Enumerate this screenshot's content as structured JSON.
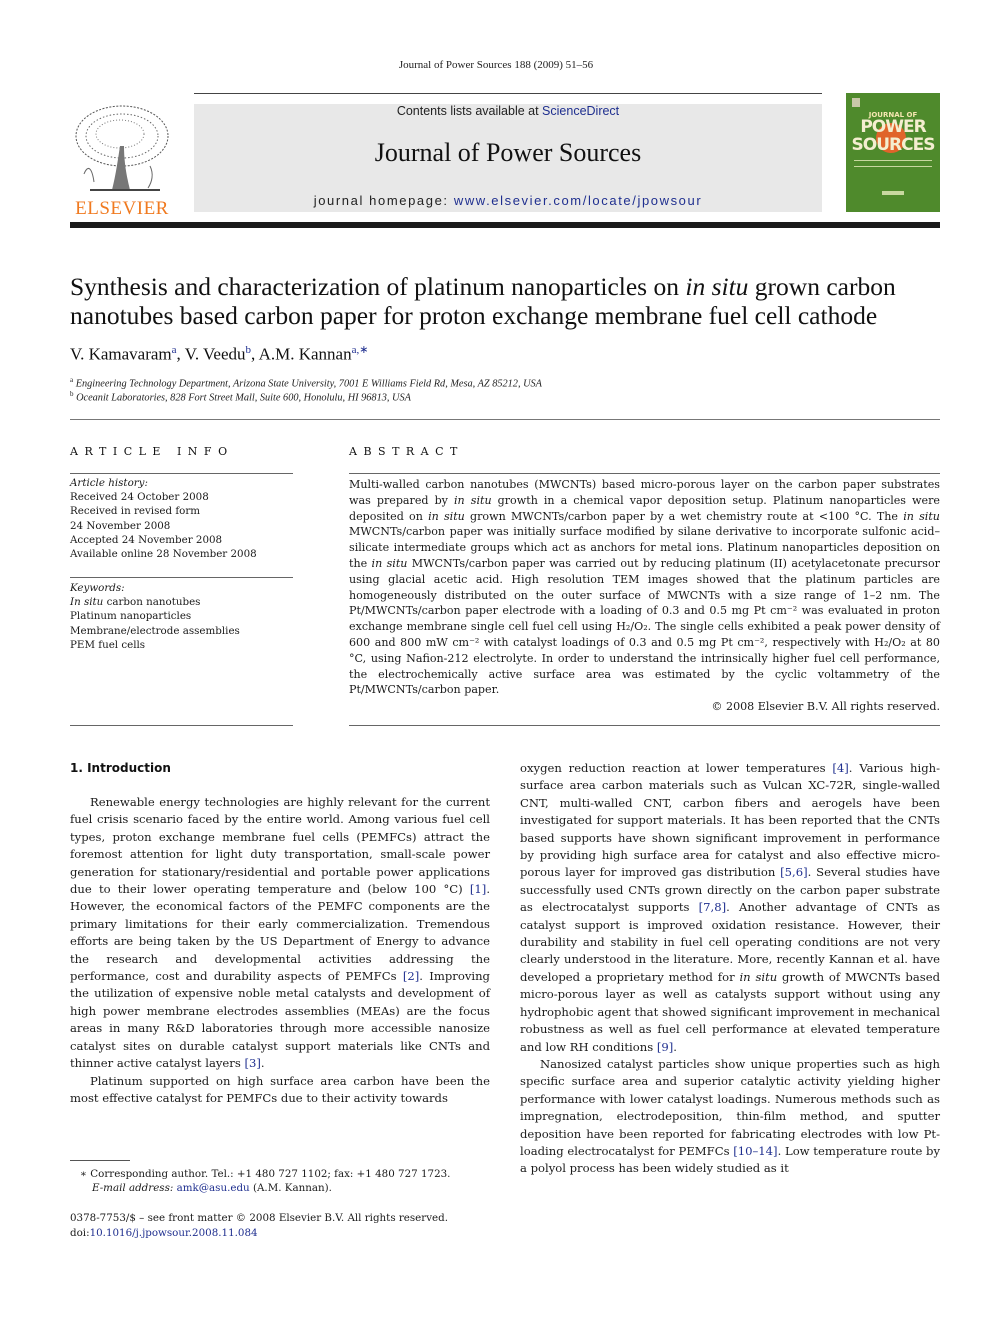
{
  "running_header": "Journal of Power Sources 188 (2009) 51–56",
  "masthead": {
    "publisher_logo_text": "ELSEVIER",
    "contents_prefix": "Contents lists available at ",
    "contents_link": "ScienceDirect",
    "journal_title": "Journal of Power Sources",
    "homepage_prefix": "journal homepage: ",
    "homepage_link": "www.elsevier.com/locate/jpowsour",
    "cover_small": "JOURNAL OF",
    "cover_title_1": "POWER",
    "cover_title_2": "SOURCES"
  },
  "article": {
    "title_part1": "Synthesis and characterization of platinum nanoparticles on ",
    "title_italic": "in situ",
    "title_part2": " grown carbon nanotubes based carbon paper for proton exchange membrane fuel cell cathode",
    "authors": [
      {
        "name": "V. Kamavaram",
        "sup": "a",
        "sep": ", "
      },
      {
        "name": "V. Veedu",
        "sup": "b",
        "sep": ", "
      },
      {
        "name": "A.M. Kannan",
        "sup": "a,∗",
        "sep": ""
      }
    ],
    "affiliations": [
      {
        "sup": "a",
        "text": "Engineering Technology Department, Arizona State University, 7001 E Williams Field Rd, Mesa, AZ 85212, USA"
      },
      {
        "sup": "b",
        "text": "Oceanit Laboratories, 828 Fort Street Mall, Suite 600, Honolulu, HI 96813, USA"
      }
    ]
  },
  "article_info": {
    "heading": "ARTICLE INFO",
    "history_label": "Article history:",
    "history": [
      "Received 24 October 2008",
      "Received in revised form",
      "24 November 2008",
      "Accepted 24 November 2008",
      "Available online 28 November 2008"
    ],
    "keywords_label": "Keywords:",
    "keyword_1_italic": "In situ",
    "keyword_1_rest": " carbon nanotubes",
    "keywords": [
      "Platinum nanoparticles",
      "Membrane/electrode assemblies",
      "PEM fuel cells"
    ]
  },
  "abstract": {
    "heading": "ABSTRACT",
    "segments": [
      {
        "t": "Multi-walled carbon nanotubes (MWCNTs) based micro-porous layer on the carbon paper substrates was prepared by "
      },
      {
        "t": "in situ",
        "i": true
      },
      {
        "t": " growth in a chemical vapor deposition setup. Platinum nanoparticles were deposited on "
      },
      {
        "t": "in situ",
        "i": true
      },
      {
        "t": " grown MWCNTs/carbon paper by a wet chemistry route at <100 °C. The "
      },
      {
        "t": "in situ",
        "i": true
      },
      {
        "t": " MWCNTs/carbon paper was initially surface modified by silane derivative to incorporate sulfonic acid–silicate intermediate groups which act as anchors for metal ions. Platinum nanoparticles deposition on the "
      },
      {
        "t": "in situ",
        "i": true
      },
      {
        "t": " MWCNTs/carbon paper was carried out by reducing platinum (II) acetylacetonate precursor using glacial acetic acid. High resolution TEM images showed that the platinum particles are homogeneously distributed on the outer surface of MWCNTs with a size range of 1–2 nm. The Pt/MWCNTs/carbon paper electrode with a loading of 0.3 and 0.5 mg Pt cm⁻² was evaluated in proton exchange membrane single cell fuel cell using H₂/O₂. The single cells exhibited a peak power density of 600 and 800 mW cm⁻² with catalyst loadings of 0.3 and 0.5 mg Pt cm⁻², respectively with H₂/O₂ at 80 °C, using Nafion-212 electrolyte. In order to understand the intrinsically higher fuel cell performance, the electrochemically active surface area was estimated by the cyclic voltammetry of the Pt/MWCNTs/carbon paper."
      }
    ],
    "copyright": "© 2008 Elsevier B.V. All rights reserved."
  },
  "introduction": {
    "heading": "1.  Introduction",
    "left_paragraphs": [
      [
        {
          "t": "Renewable energy technologies are highly relevant for the current fuel crisis scenario faced by the entire world. Among various fuel cell types, proton exchange membrane fuel cells (PEMFCs) attract the foremost attention for light duty transportation, small-scale power generation for stationary/residential and portable power applications due to their lower operating temperature and (below 100 °C) "
        },
        {
          "t": "[1]",
          "ref": true
        },
        {
          "t": ". However, the economical factors of the PEMFC components are the primary limitations for their early commercialization. Tremendous efforts are being taken by the US Department of Energy to advance the research and developmental activities addressing the performance, cost and durability aspects of PEMFCs "
        },
        {
          "t": "[2]",
          "ref": true
        },
        {
          "t": ". Improving the utilization of expensive noble metal catalysts and development of high power membrane electrodes assemblies (MEAs) are the focus areas in many R&D laboratories through more accessible nanosize catalyst sites on durable catalyst support materials like CNTs and thinner active catalyst layers "
        },
        {
          "t": "[3]",
          "ref": true
        },
        {
          "t": "."
        }
      ],
      [
        {
          "t": "Platinum supported on high surface area carbon have been the most effective catalyst for PEMFCs due to their activity towards"
        }
      ]
    ],
    "right_paragraphs": [
      [
        {
          "t": "oxygen reduction reaction at lower temperatures "
        },
        {
          "t": "[4]",
          "ref": true
        },
        {
          "t": ". Various high-surface area carbon materials such as Vulcan XC-72R, single-walled CNT, multi-walled CNT, carbon fibers and aerogels have been investigated for support materials. It has been reported that the CNTs based supports have shown significant improvement in performance by providing high surface area for catalyst and also effective micro-porous layer for improved gas distribution "
        },
        {
          "t": "[5,6]",
          "ref": true
        },
        {
          "t": ". Several studies have successfully used CNTs grown directly on the carbon paper substrate as electrocatalyst supports "
        },
        {
          "t": "[7,8]",
          "ref": true
        },
        {
          "t": ". Another advantage of CNTs as catalyst support is improved oxidation resistance. However, their durability and stability in fuel cell operating conditions are not very clearly understood in the literature. More, recently Kannan et al. have developed a proprietary method for "
        },
        {
          "t": "in situ",
          "i": true
        },
        {
          "t": " growth of MWCNTs based micro-porous layer as well as catalysts support without using any hydrophobic agent that showed significant improvement in mechanical robustness as well as fuel cell performance at elevated temperature and low RH conditions "
        },
        {
          "t": "[9]",
          "ref": true
        },
        {
          "t": "."
        }
      ],
      [
        {
          "t": "Nanosized catalyst particles show unique properties such as high specific surface area and superior catalytic activity yielding higher performance with lower catalyst loadings. Numerous methods such as impregnation, electrodeposition, thin-film method, and sputter deposition have been reported for fabricating electrodes with low Pt-loading electrocatalyst for PEMFCs "
        },
        {
          "t": "[10–14]",
          "ref": true
        },
        {
          "t": ". Low temperature route by a polyol process has been widely studied as it"
        }
      ]
    ]
  },
  "footnotes": {
    "corresponding": "∗   Corresponding author. Tel.: +1 480 727 1102; fax: +1 480 727 1723.",
    "email_label": "E-mail address: ",
    "email": "amk@asu.edu",
    "email_suffix": " (A.M. Kannan).",
    "front_matter": "0378-7753/$ – see front matter © 2008 Elsevier B.V. All rights reserved.",
    "doi_prefix": "doi:",
    "doi": "10.1016/j.jpowsour.2008.11.084"
  }
}
